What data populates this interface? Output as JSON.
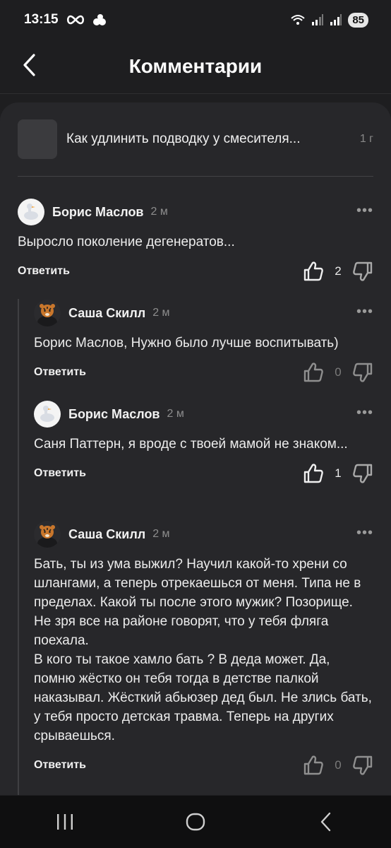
{
  "status": {
    "time": "13:15",
    "battery": "85",
    "network": "5"
  },
  "header": {
    "title": "Комментарии"
  },
  "article": {
    "title": "Как удлинить подводку у смесителя...",
    "time": "1 г"
  },
  "comments": [
    {
      "author": "Борис Маслов",
      "time": "2 м",
      "text": "Выросло поколение дегенератов...",
      "reply_label": "Ответить",
      "likes": "2",
      "liked": true
    },
    {
      "author": "Саша Скилл",
      "time": "2 м",
      "text": "Борис Маслов, Нужно было лучше воспитывать)",
      "reply_label": "Ответить",
      "likes": "0",
      "liked": false
    },
    {
      "author": "Борис Маслов",
      "time": "2 м",
      "text": "Саня Паттерн, я вроде с твоей мамой не знаком...",
      "reply_label": "Ответить",
      "likes": "1",
      "liked": true
    },
    {
      "author": "Саша Скилл",
      "time": "2 м",
      "text": "Бать, ты из ума выжил? Научил какой-то хрени со шлангами, а теперь отрекаешься от меня. Типа не в пределах. Какой ты после этого мужик? Позорище. Не зря все на районе говорят, что у тебя фляга поехала.\nВ кого ты такое хамло бать ? В деда может. Да, помню жёстко он тебя тогда в детстве палкой наказывал. Жёсткий абьюзер дед был. Не злись бать, у тебя просто детская травма. Теперь на других срываешься.",
      "reply_label": "Ответить",
      "likes": "0",
      "liked": false
    }
  ],
  "icons": {
    "back": "chevron-left-icon",
    "more": "more-horizontal-icon",
    "like": "thumbs-up-icon",
    "dislike": "thumbs-down-icon",
    "nav_recent": "recent-apps-icon",
    "nav_home": "home-icon",
    "nav_back": "back-icon"
  },
  "colors": {
    "background": "#1e1e20",
    "panel": "#27272a",
    "text": "#eaeaea",
    "muted": "#8d8d8d"
  }
}
